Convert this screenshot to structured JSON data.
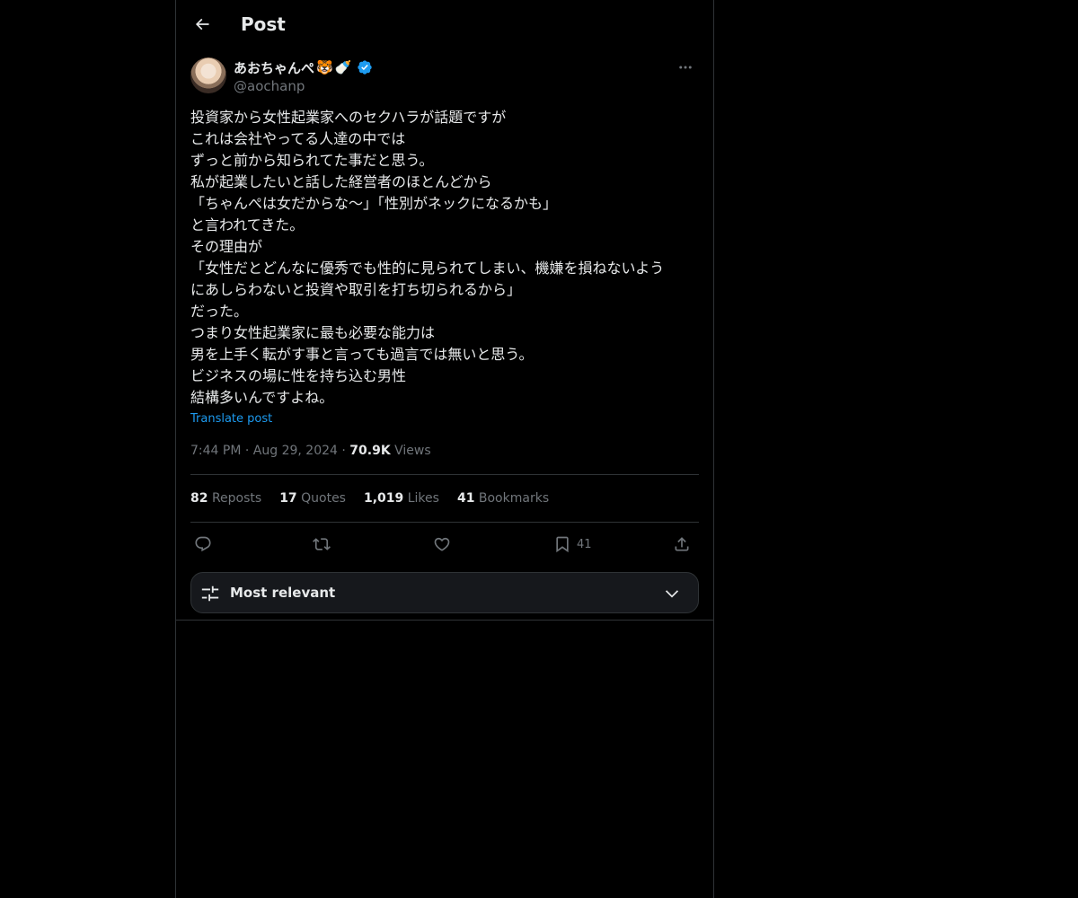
{
  "header": {
    "title": "Post"
  },
  "author": {
    "display_name": "あおちゃんぺ",
    "emoji": [
      "🐯",
      "🍼"
    ],
    "handle": "@aochanp",
    "verified": true
  },
  "tweet": {
    "lines": [
      "投資家から女性起業家へのセクハラが話題ですが",
      "これは会社やってる人達の中では",
      "ずっと前から知られてた事だと思う。",
      "私が起業したいと話した経営者のほとんどから",
      "「ちゃんぺは女だからな〜」「性別がネックになるかも」",
      "と言われてきた。",
      "その理由が",
      "「女性だとどんなに優秀でも性的に見られてしまい、機嫌を損ねないよう",
      "にあしらわないと投資や取引を打ち切られるから」",
      "だった。",
      "つまり女性起業家に最も必要な能力は",
      "男を上手く転がす事と言っても過言では無いと思う。",
      "ビジネスの場に性を持ち込む男性",
      "結構多いんですよね。"
    ],
    "translate_label": "Translate post"
  },
  "meta": {
    "time": "7:44 PM",
    "date": "Aug 29, 2024",
    "views_count": "70.9K",
    "views_label": "Views",
    "separator": "·"
  },
  "stats": {
    "reposts": {
      "count": "82",
      "label": "Reposts"
    },
    "quotes": {
      "count": "17",
      "label": "Quotes"
    },
    "likes": {
      "count": "1,019",
      "label": "Likes"
    },
    "bookmarks": {
      "count": "41",
      "label": "Bookmarks"
    }
  },
  "actions": {
    "bookmark_count": "41"
  },
  "sort": {
    "label": "Most relevant"
  },
  "colors": {
    "background": "#000000",
    "text": "#e7e9ea",
    "secondary": "#71767b",
    "accent": "#1d9bf0",
    "border": "#2f3336"
  }
}
